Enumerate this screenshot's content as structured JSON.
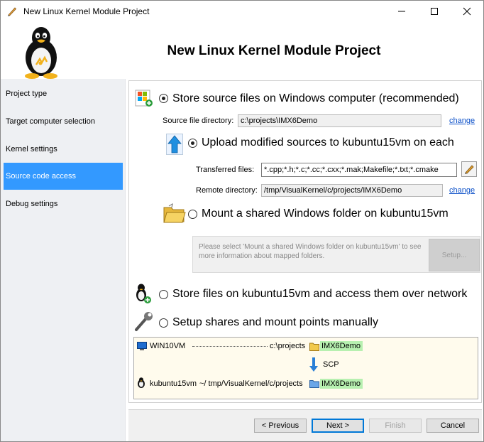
{
  "window": {
    "title": "New Linux Kernel Module Project"
  },
  "header": {
    "heading": "New Linux Kernel Module Project"
  },
  "sidebar": {
    "items": [
      {
        "label": "Project type"
      },
      {
        "label": "Target computer selection"
      },
      {
        "label": "Kernel settings"
      },
      {
        "label": "Source code access"
      },
      {
        "label": "Debug settings"
      }
    ],
    "active_index": 3
  },
  "options": {
    "store_windows": {
      "label": "Store source files on Windows computer (recommended)",
      "selected": true,
      "source_dir_label": "Source file directory:",
      "source_dir_value": "c:\\projects\\IMX6Demo",
      "change_label": "change"
    },
    "upload": {
      "label": "Upload modified sources to kubuntu15vm on each",
      "selected": true,
      "transferred_label": "Transferred files:",
      "transferred_value": "*.cpp;*.h;*.c;*.cc;*.cxx;*.mak;Makefile;*.txt;*.cmake",
      "remote_label": "Remote directory:",
      "remote_value": "/tmp/VisualKernel/c/projects/IMX6Demo",
      "change_label": "change"
    },
    "mount": {
      "label": "Mount a shared Windows folder on kubuntu15vm",
      "selected": false,
      "message": "Please select 'Mount a shared Windows folder on kubuntu15vm' to see more information about mapped folders.",
      "setup_label": "Setup..."
    },
    "store_linux": {
      "label": "Store files on kubuntu15vm and access them over network",
      "selected": false
    },
    "manual": {
      "label": "Setup shares and mount points manually",
      "selected": false
    }
  },
  "diagram": {
    "windows_host": "WIN10VM",
    "windows_path": "c:\\projects",
    "windows_folder": "IMX6Demo",
    "transfer": "SCP",
    "linux_host": "kubuntu15vm",
    "linux_path": "~/ tmp/VisualKernel/c/projects",
    "linux_folder": "IMX6Demo"
  },
  "footer": {
    "previous_label": "< Previous",
    "next_label": "Next >",
    "finish_label": "Finish",
    "cancel_label": "Cancel"
  },
  "colors": {
    "accent": "#3399ff",
    "link": "#0a4fc8",
    "chip": "#b7f0b0"
  }
}
